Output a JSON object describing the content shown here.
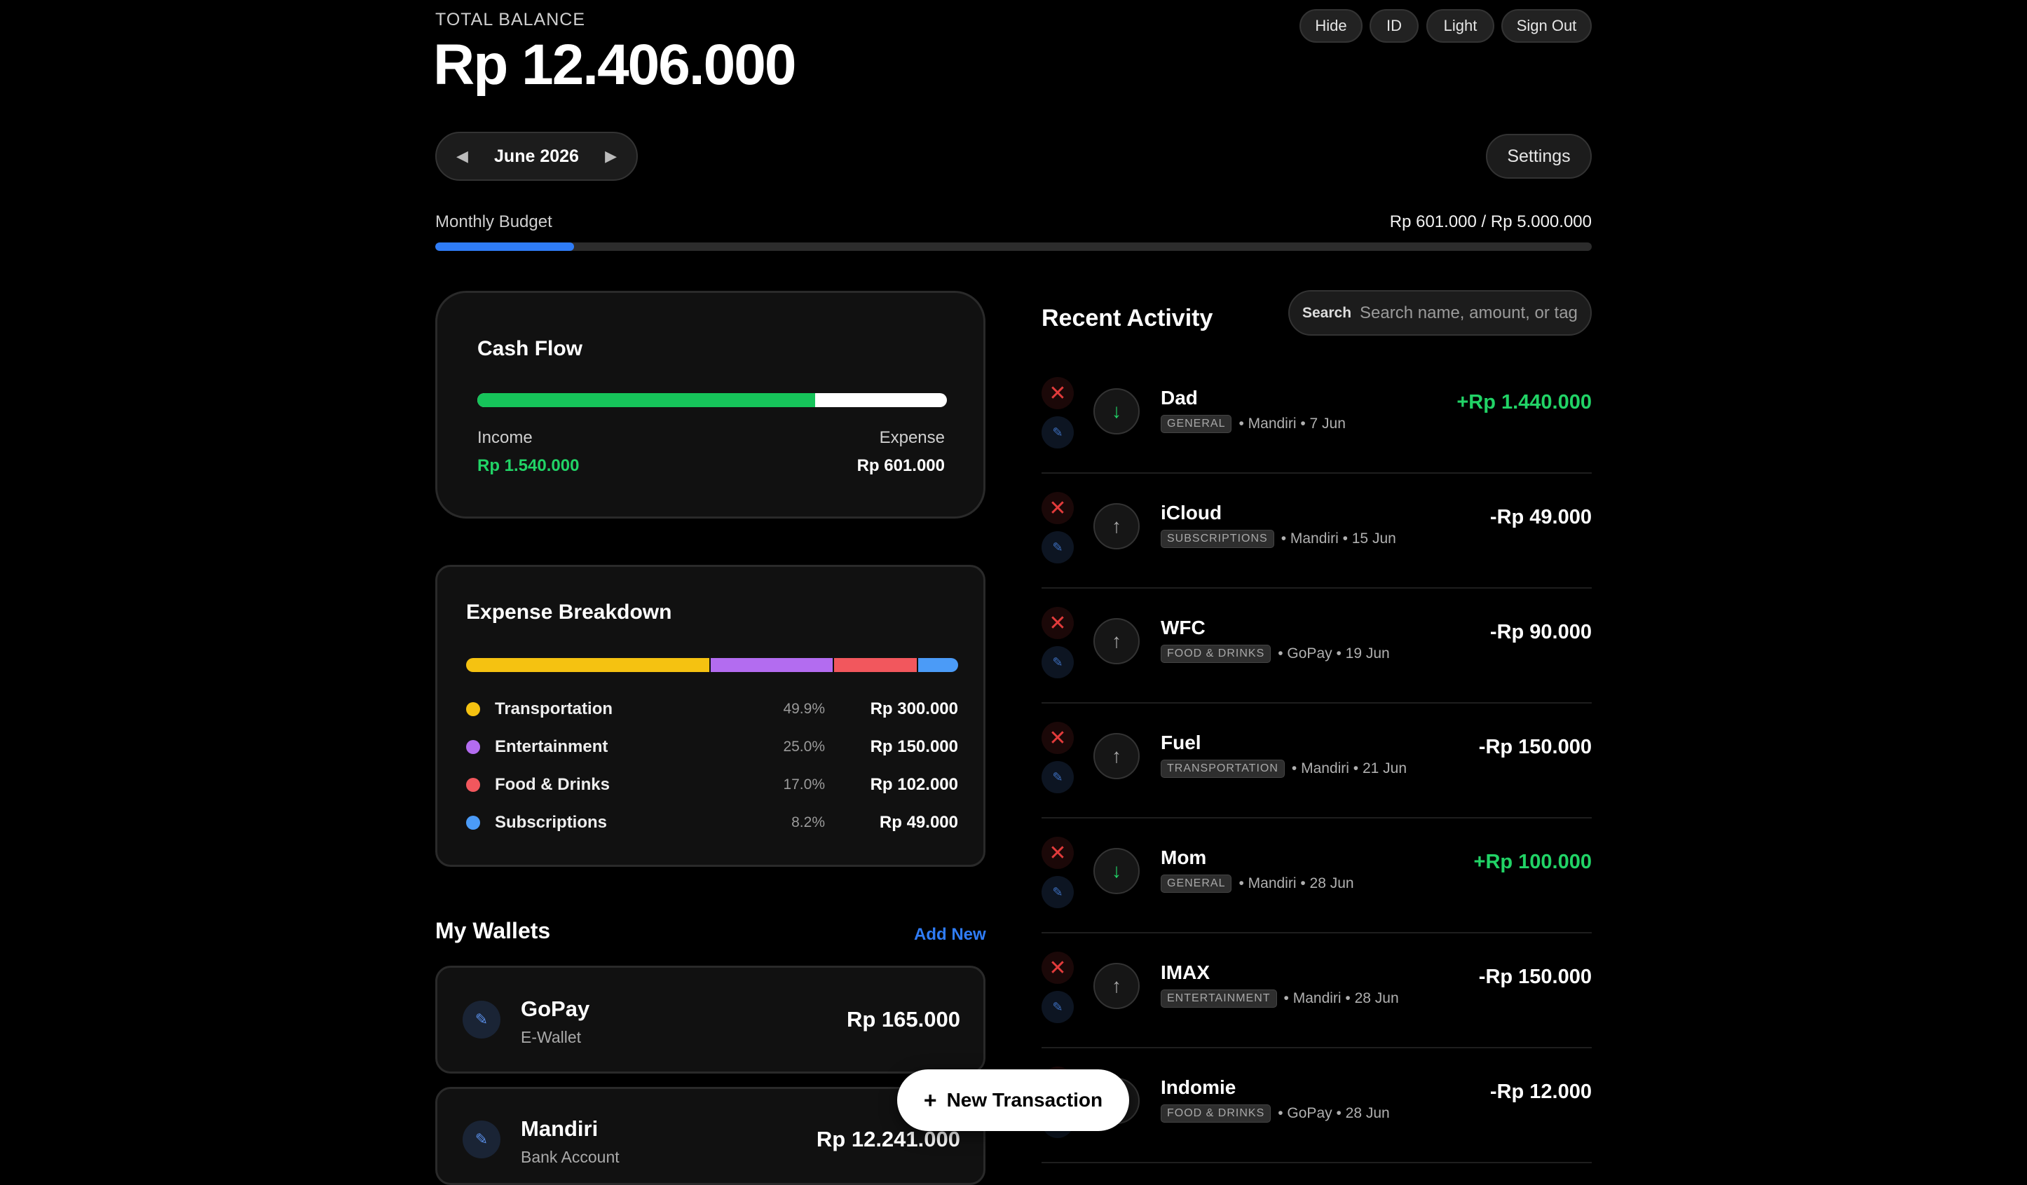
{
  "header": {
    "total_label": "TOTAL BALANCE",
    "total_amount": "Rp 12.406.000",
    "buttons": {
      "hide": "Hide",
      "lang": "ID",
      "theme": "Light",
      "sign_out": "Sign Out"
    }
  },
  "month_nav": {
    "prev": "◀",
    "label": "June 2026",
    "next": "▶"
  },
  "settings_label": "Settings",
  "budget": {
    "label": "Monthly Budget",
    "value": "Rp 601.000 / Rp 5.000.000",
    "fraction": 0.12
  },
  "cash_flow": {
    "title": "Cash Flow",
    "income_label": "Income",
    "income_value": "Rp 1.540.000",
    "expense_label": "Expense",
    "expense_value": "Rp 601.000",
    "income_fraction": 0.719
  },
  "expense_breakdown": {
    "title": "Expense Breakdown",
    "items": [
      {
        "name": "Transportation",
        "pct": "49.9%",
        "amount": "Rp 300.000",
        "color": "#f5c211",
        "share": 49.9
      },
      {
        "name": "Entertainment",
        "pct": "25.0%",
        "amount": "Rp 150.000",
        "color": "#b36cf0",
        "share": 25.0
      },
      {
        "name": "Food & Drinks",
        "pct": "17.0%",
        "amount": "Rp 102.000",
        "color": "#f2575d",
        "share": 17.0
      },
      {
        "name": "Subscriptions",
        "pct": "8.2%",
        "amount": "Rp 49.000",
        "color": "#4b9bf7",
        "share": 8.2
      }
    ]
  },
  "wallets": {
    "title": "My Wallets",
    "add_label": "Add New",
    "items": [
      {
        "name": "GoPay",
        "type": "E-Wallet",
        "balance": "Rp 165.000",
        "edit_icon": "✎"
      },
      {
        "name": "Mandiri",
        "type": "Bank Account",
        "balance": "Rp 12.241.000",
        "edit_icon": "✎"
      }
    ]
  },
  "recent_activity": {
    "title": "Recent Activity",
    "search_label": "Search",
    "search_placeholder": "Search name, amount, or tag",
    "transactions": [
      {
        "name": "Dad",
        "tag": "GENERAL",
        "meta": "• Mandiri • 7 Jun",
        "amount": "+Rp 1.440.000",
        "direction": "in"
      },
      {
        "name": "iCloud",
        "tag": "SUBSCRIPTIONS",
        "meta": "• Mandiri • 15 Jun",
        "amount": "-Rp 49.000",
        "direction": "out"
      },
      {
        "name": "WFC",
        "tag": "FOOD & DRINKS",
        "meta": "• GoPay • 19 Jun",
        "amount": "-Rp 90.000",
        "direction": "out"
      },
      {
        "name": "Fuel",
        "tag": "TRANSPORTATION",
        "meta": "• Mandiri • 21 Jun",
        "amount": "-Rp 150.000",
        "direction": "out"
      },
      {
        "name": "Mom",
        "tag": "GENERAL",
        "meta": "• Mandiri • 28 Jun",
        "amount": "+Rp 100.000",
        "direction": "in"
      },
      {
        "name": "IMAX",
        "tag": "ENTERTAINMENT",
        "meta": "• Mandiri • 28 Jun",
        "amount": "-Rp 150.000",
        "direction": "out"
      },
      {
        "name": "Indomie",
        "tag": "FOOD & DRINKS",
        "meta": "• GoPay • 28 Jun",
        "amount": "-Rp 12.000",
        "direction": "out"
      }
    ]
  },
  "fab": {
    "icon": "+",
    "label": "New Transaction"
  },
  "icons": {
    "delete": "✕",
    "edit": "✎",
    "arrow_in": "↓",
    "arrow_out": "↑"
  }
}
